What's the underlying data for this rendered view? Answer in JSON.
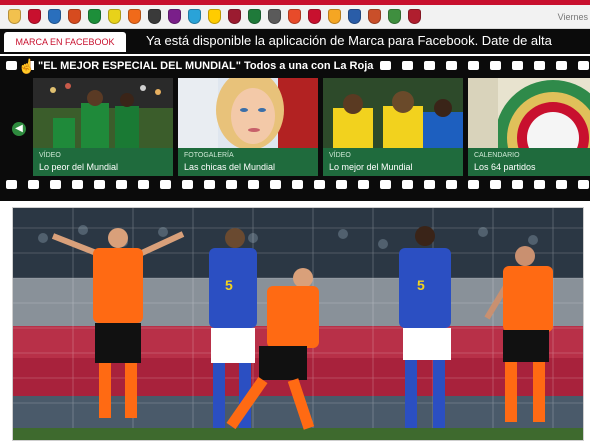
{
  "club_strip": {
    "crest_colors": [
      "#f2c14e",
      "#c8102e",
      "#2a6fbd",
      "#d64b1f",
      "#1d8f3a",
      "#e8d21a",
      "#f06a1a",
      "#3a3a3a",
      "#7a1f8a",
      "#2aa3d8",
      "#ffcc00",
      "#9b1b30",
      "#1f7a3a",
      "#5a5a5a",
      "#e84b2a",
      "#c8102e",
      "#f5a623",
      "#2a5da8",
      "#c94f2a",
      "#3f8f3f",
      "#b01e2e"
    ],
    "date_label": "Viernes"
  },
  "facebook_bar": {
    "tab_label": "MARCA EN FACEBOOK",
    "message": "Ya está disponible la aplicación de Marca para Facebook. Date de alta"
  },
  "special": {
    "title": "\"EL MEJOR ESPECIAL DEL MUNDIAL\" Todos a una con La Roja",
    "prev_icon": "chevron-left-icon",
    "cards": [
      {
        "category": "VÍDEO",
        "title": "Lo peor del Mundial"
      },
      {
        "category": "FOTOGALERÍA",
        "title": "Las chicas del Mundial"
      },
      {
        "category": "VÍDEO",
        "title": "Lo mejor del Mundial"
      },
      {
        "category": "CALENDARIO",
        "title": "Los 64 partidos"
      }
    ]
  },
  "main_photo": {
    "kits": {
      "orange": "#ff6a13",
      "blue": "#2b4fc2",
      "white": "#ffffff",
      "black": "#111111"
    },
    "numbers": [
      "5",
      "5"
    ]
  }
}
